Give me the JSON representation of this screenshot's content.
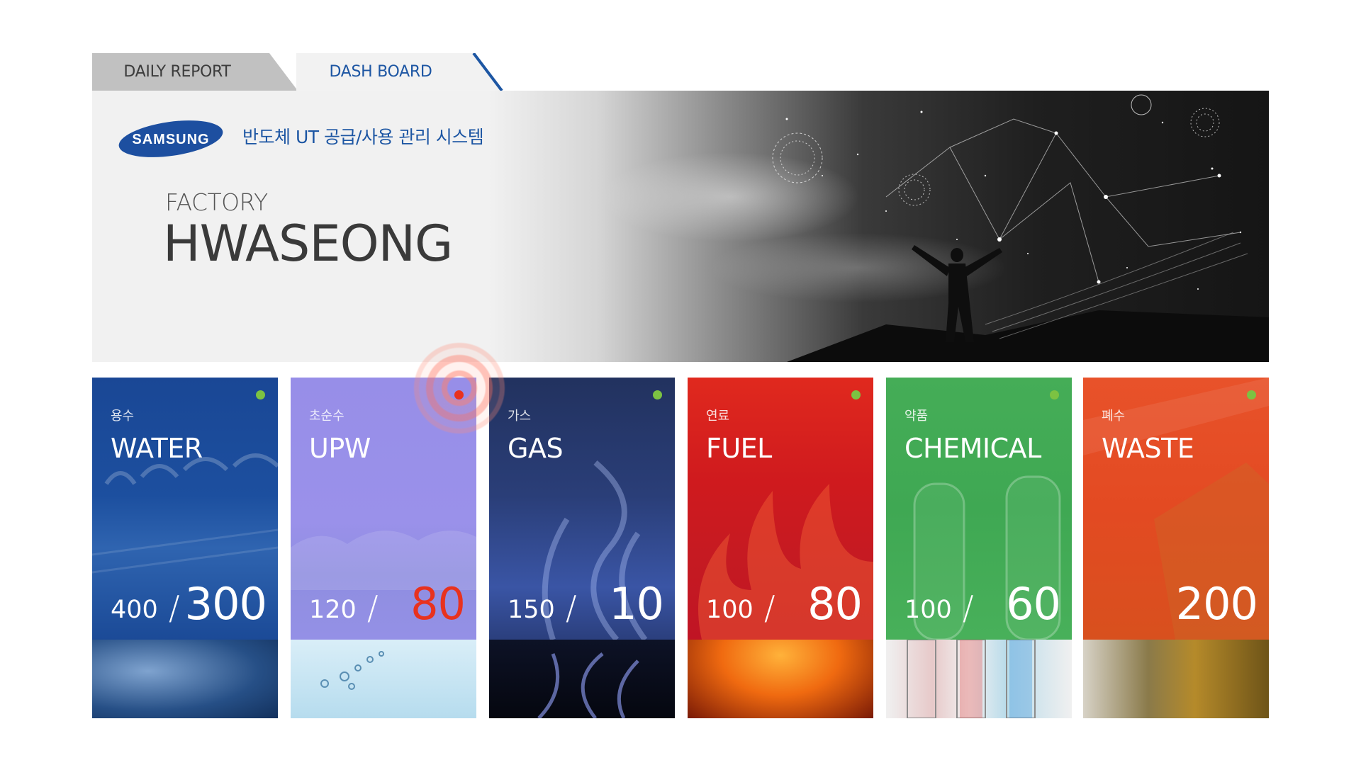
{
  "tabs": [
    {
      "label": "DAILY REPORT",
      "active": false
    },
    {
      "label": "DASH BOARD",
      "active": true
    }
  ],
  "header": {
    "logo_text": "SAMSUNG",
    "subtitle": "반도체 UT 공급/사용 관리 시스템",
    "factory_label": "FACTORY",
    "factory_name": "HWASEONG"
  },
  "colors": {
    "brand_blue": "#1d56a3",
    "status_ok": "#7cc242",
    "status_alert": "#e8321e"
  },
  "cards": [
    {
      "kr": "용수",
      "en": "WATER",
      "value1": "400",
      "value2": "300",
      "status": "ok",
      "color": "#1c4f9f"
    },
    {
      "kr": "초순수",
      "en": "UPW",
      "value1": "120",
      "value2": "80",
      "status": "alert",
      "color": "#978ee8"
    },
    {
      "kr": "가스",
      "en": "GAS",
      "value1": "150",
      "value2": "10",
      "status": "ok",
      "color": "#25366b"
    },
    {
      "kr": "연료",
      "en": "FUEL",
      "value1": "100",
      "value2": "80",
      "status": "ok",
      "color": "#c8141c"
    },
    {
      "kr": "약품",
      "en": "CHEMICAL",
      "value1": "100",
      "value2": "60",
      "status": "ok",
      "color": "#3fa853"
    },
    {
      "kr": "폐수",
      "en": "WASTE",
      "value2": "200",
      "status": "ok",
      "color": "#e34a22"
    }
  ]
}
